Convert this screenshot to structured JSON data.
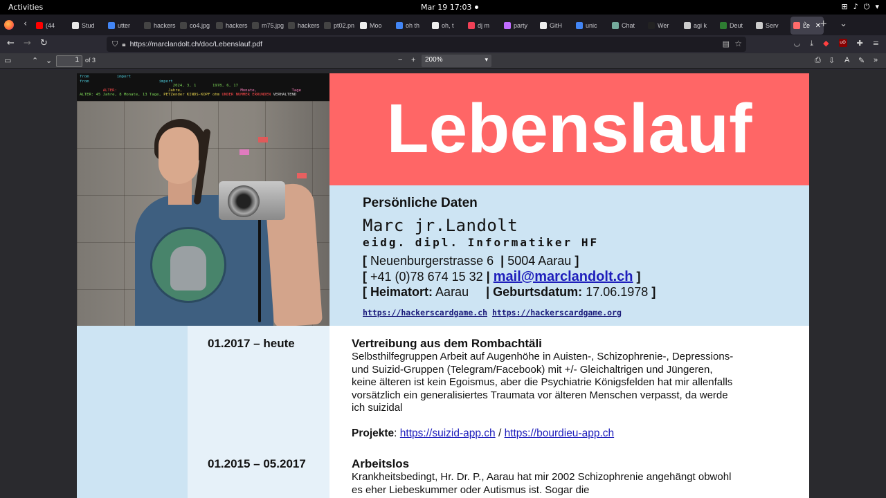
{
  "topbar": {
    "activities": "Activities",
    "clock": "Mar 19  17:03"
  },
  "browser": {
    "tabs": [
      {
        "label": "(44",
        "color": "#ff0000"
      },
      {
        "label": "Stud",
        "color": "#e8e8e8"
      },
      {
        "label": "utter",
        "color": "#4285f4"
      },
      {
        "label": "hackers",
        "color": "#444"
      },
      {
        "label": "co4.jpg",
        "color": "#444"
      },
      {
        "label": "hackers",
        "color": "#444"
      },
      {
        "label": "m75.jpg",
        "color": "#444"
      },
      {
        "label": "hackers",
        "color": "#444"
      },
      {
        "label": "pt02.pn",
        "color": "#444"
      },
      {
        "label": "Moo",
        "color": "#eee"
      },
      {
        "label": "oh th",
        "color": "#4285f4"
      },
      {
        "label": "oh, t",
        "color": "#eee"
      },
      {
        "label": "dj m",
        "color": "#ef4056"
      },
      {
        "label": "party",
        "color": "#c06cff"
      },
      {
        "label": "GitH",
        "color": "#eee"
      },
      {
        "label": "unic",
        "color": "#4285f4"
      },
      {
        "label": "Chat",
        "color": "#74aa9c"
      },
      {
        "label": "Wer",
        "color": "#222"
      },
      {
        "label": "agi k",
        "color": "#ccc"
      },
      {
        "label": "Deut",
        "color": "#2e7d32"
      },
      {
        "label": "Serv",
        "color": "#ccc"
      }
    ],
    "active_tab": {
      "label": "Le",
      "color": "#ff6b6b"
    },
    "url": "https://marclandolt.ch/doc/Lebenslauf.pdf"
  },
  "pdf_toolbar": {
    "page_current": "1",
    "page_total": "of 3",
    "zoom": "200%"
  },
  "photo_banner": {
    "line1a": "from",
    "line1b": "import",
    "line2a": "from",
    "line2b": "import",
    "line2c": "2024, 3, 1",
    "line2d": "1978, 6, 17",
    "line3a": "ALTER:",
    "line3b": "Jahre,",
    "line3c": "Monate,",
    "line3d": "Tage",
    "line4a": "ALTER: 45 Jahre, 8 Monate, 13 Tage,",
    "line4b": "PETZender KINDS-KOPF ohm",
    "line4c": "UNDER NUMMER ERRUNDEN",
    "line4d": "VERHALTEND"
  },
  "cv": {
    "title": "Lebenslauf",
    "personal": {
      "heading": "Persönliche Daten",
      "signature": "Marc jr.Landolt",
      "degree": "eidg. dipl. Informatiker HF",
      "open_bracket": "[",
      "close_bracket": "]",
      "sep": "|",
      "street": "Neuenburgerstrasse 6",
      "city": "5004 Aarau",
      "phone": "+41 (0)78 674 15 32",
      "email": "mail@marclandolt.ch",
      "hometown_label": "Heimatort:",
      "hometown": "Aarau",
      "birth_label": "Geburtsdatum:",
      "birth": "17.06.1978",
      "link1": "https://hackerscardgame.ch",
      "link2": "https://hackerscardgame.org"
    },
    "entries": [
      {
        "date": "01.2017 – heute",
        "title": "Vertreibung aus dem Rombachtäli",
        "body": "Selbsthilfegruppen Arbeit auf Augenhöhe in Auisten-, Schizophrenie-, Depressions- und Suizid-Gruppen (Telegram/Facebook) mit +/- Gleichaltrigen und Jüngeren, keine älteren ist kein Egoismus, aber die Psychiatrie Königsfelden hat mir allenfalls vorsätzlich ein generalisiertes Traumata vor älteren Menschen verpasst, da werde ich suizidal",
        "projects_label": "Projekte",
        "projects_colon": ":",
        "project1": "https://suizid-app.ch",
        "projects_sep": " / ",
        "project2": "https://bourdieu-app.ch"
      },
      {
        "date": "01.2015 – 05.2017",
        "title": "Arbeitslos",
        "body": "Krankheitsbedingt, Hr. Dr. P., Aarau hat mir 2002 Schizophrenie angehängt obwohl es eher Liebeskummer oder Autismus ist. Sogar die"
      }
    ]
  }
}
